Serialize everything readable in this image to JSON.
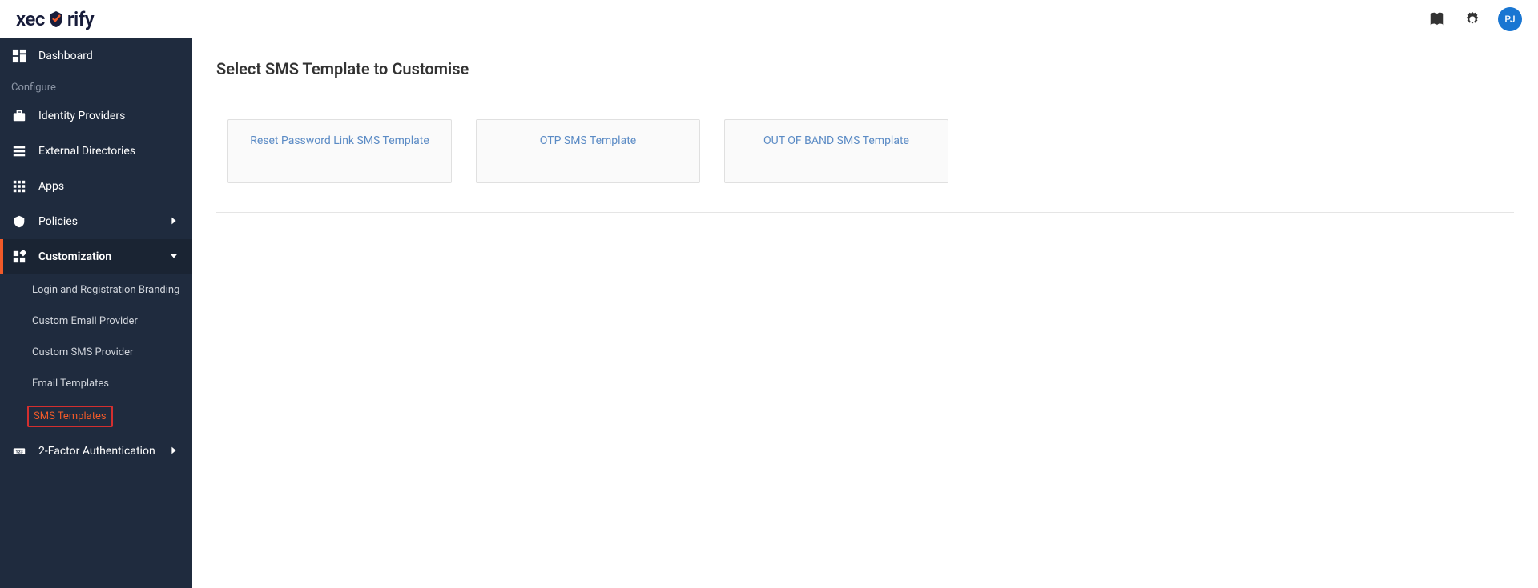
{
  "header": {
    "logo_part1": "xec",
    "logo_part2": "rify",
    "avatar_initials": "PJ"
  },
  "sidebar": {
    "dashboard_label": "Dashboard",
    "configure_section": "Configure",
    "identity_providers_label": "Identity Providers",
    "external_directories_label": "External Directories",
    "apps_label": "Apps",
    "policies_label": "Policies",
    "customization_label": "Customization",
    "sub_items": {
      "login_branding": "Login and Registration Branding",
      "custom_email": "Custom Email Provider",
      "custom_sms": "Custom SMS Provider",
      "email_templates": "Email Templates",
      "sms_templates": "SMS Templates"
    },
    "two_factor_label": "2-Factor Authentication"
  },
  "main": {
    "page_title": "Select SMS Template to Customise",
    "templates": {
      "reset_password": "Reset Password Link SMS Template",
      "otp": "OTP SMS Template",
      "out_of_band": "OUT OF BAND SMS Template"
    }
  }
}
